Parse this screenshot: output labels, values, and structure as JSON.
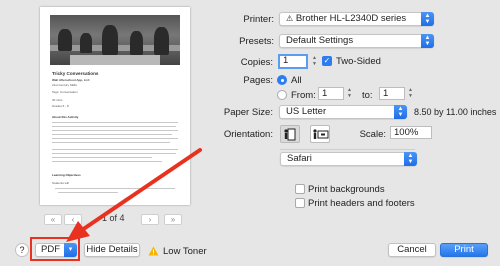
{
  "preview": {
    "title": "Tricky Conversations",
    "subtitle": "Walt Afterschool App, LLC",
    "line3": "21st Century Skills",
    "tags": "Tags: Conversation",
    "meta1": "30 mins",
    "meta2": "Grades 6 - 8",
    "section1": "About this Activity",
    "section2": "Learning Objectives",
    "section3": "Students will",
    "pager": {
      "first": "«",
      "prev": "‹",
      "label": "1 of 4",
      "next": "›",
      "last": "»"
    }
  },
  "form": {
    "printer_label": "Printer:",
    "printer_value": "Brother HL-L2340D series",
    "presets_label": "Presets:",
    "presets_value": "Default Settings",
    "copies_label": "Copies:",
    "copies_value": "1",
    "two_sided_label": "Two-Sided",
    "pages_label": "Pages:",
    "pages_all": "All",
    "pages_from_label": "From:",
    "pages_from_value": "1",
    "pages_to_label": "to:",
    "pages_to_value": "1",
    "paper_size_label": "Paper Size:",
    "paper_size_value": "US Letter",
    "paper_size_dims": "8.50 by 11.00 inches",
    "orientation_label": "Orientation:",
    "scale_label": "Scale:",
    "scale_value": "100%",
    "section_value": "Safari",
    "print_backgrounds": "Print backgrounds",
    "print_headers": "Print headers and footers"
  },
  "bottom": {
    "help": "?",
    "pdf": "PDF",
    "hide_details": "Hide Details",
    "low_toner": "Low Toner",
    "cancel": "Cancel",
    "print": "Print"
  },
  "colors": {
    "accent": "#2d7cf0",
    "annotation": "#e8321f"
  }
}
